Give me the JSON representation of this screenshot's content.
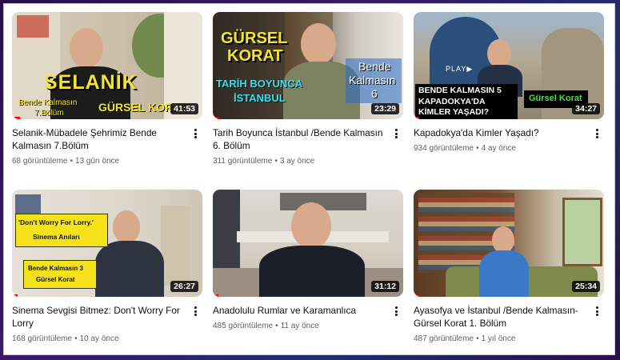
{
  "videos": [
    {
      "title": "Selanik-Mübadele Şehrimiz Bende Kalmasın 7.Bölüm",
      "views": "68 görüntüleme",
      "age": "13 gün önce",
      "duration": "41:53",
      "progress_percent": 4,
      "overlay": {
        "line1": "SELANİK",
        "line2": "Bende Kalmasın",
        "line3": "7.Bölüm",
        "line4": "GÜRSEL KORAT"
      }
    },
    {
      "title": "Tarih Boyunca İstanbul /Bende Kalmasın 6. Bölüm",
      "views": "311 görüntüleme",
      "age": "3 ay önce",
      "duration": "23:29",
      "progress_percent": 3,
      "overlay": {
        "line1": "GÜRSEL",
        "line2": "KORAT",
        "line3": "TARİH BOYUNCA",
        "line4": "İSTANBUL",
        "line5": "Bende",
        "line6": "Kalmasın",
        "line7": "6"
      }
    },
    {
      "title": "Kapadokya'da Kimler Yaşadı?",
      "views": "934 görüntüleme",
      "age": "4 ay önce",
      "duration": "34:27",
      "progress_percent": 3,
      "overlay": {
        "line1": "BENDE KALMASIN 5",
        "line2": "KAPADOKYA'DA",
        "line3": "KİMLER YAŞADI?",
        "line4": "Gürsel Korat",
        "line5": "PLAY▶"
      }
    },
    {
      "title": "Sinema Sevgisi Bitmez: Don't Worry For Lorry",
      "views": "168 görüntüleme",
      "age": "10 ay önce",
      "duration": "26:27",
      "progress_percent": 3,
      "overlay": {
        "line1": "'Don't Worry For Lorry.'",
        "line2": "Sinema Anıları",
        "line3": "Bende Kalmasın 3",
        "line4": "Gürsel Korat"
      }
    },
    {
      "title": "Anadolulu Rumlar ve Karamanlıca",
      "views": "485 görüntüleme",
      "age": "11 ay önce",
      "duration": "31:12",
      "progress_percent": 3
    },
    {
      "title": "Ayasofya ve İstanbul /Bende Kalmasın-Gürsel Korat 1. Bölüm",
      "views": "487 görüntüleme",
      "age": "1 yıl önce",
      "duration": "25:34",
      "progress_percent": 3
    }
  ],
  "separator": "•",
  "colors": {
    "progress": "#ff0000",
    "title": "#0f0f0f",
    "meta": "#606060"
  }
}
